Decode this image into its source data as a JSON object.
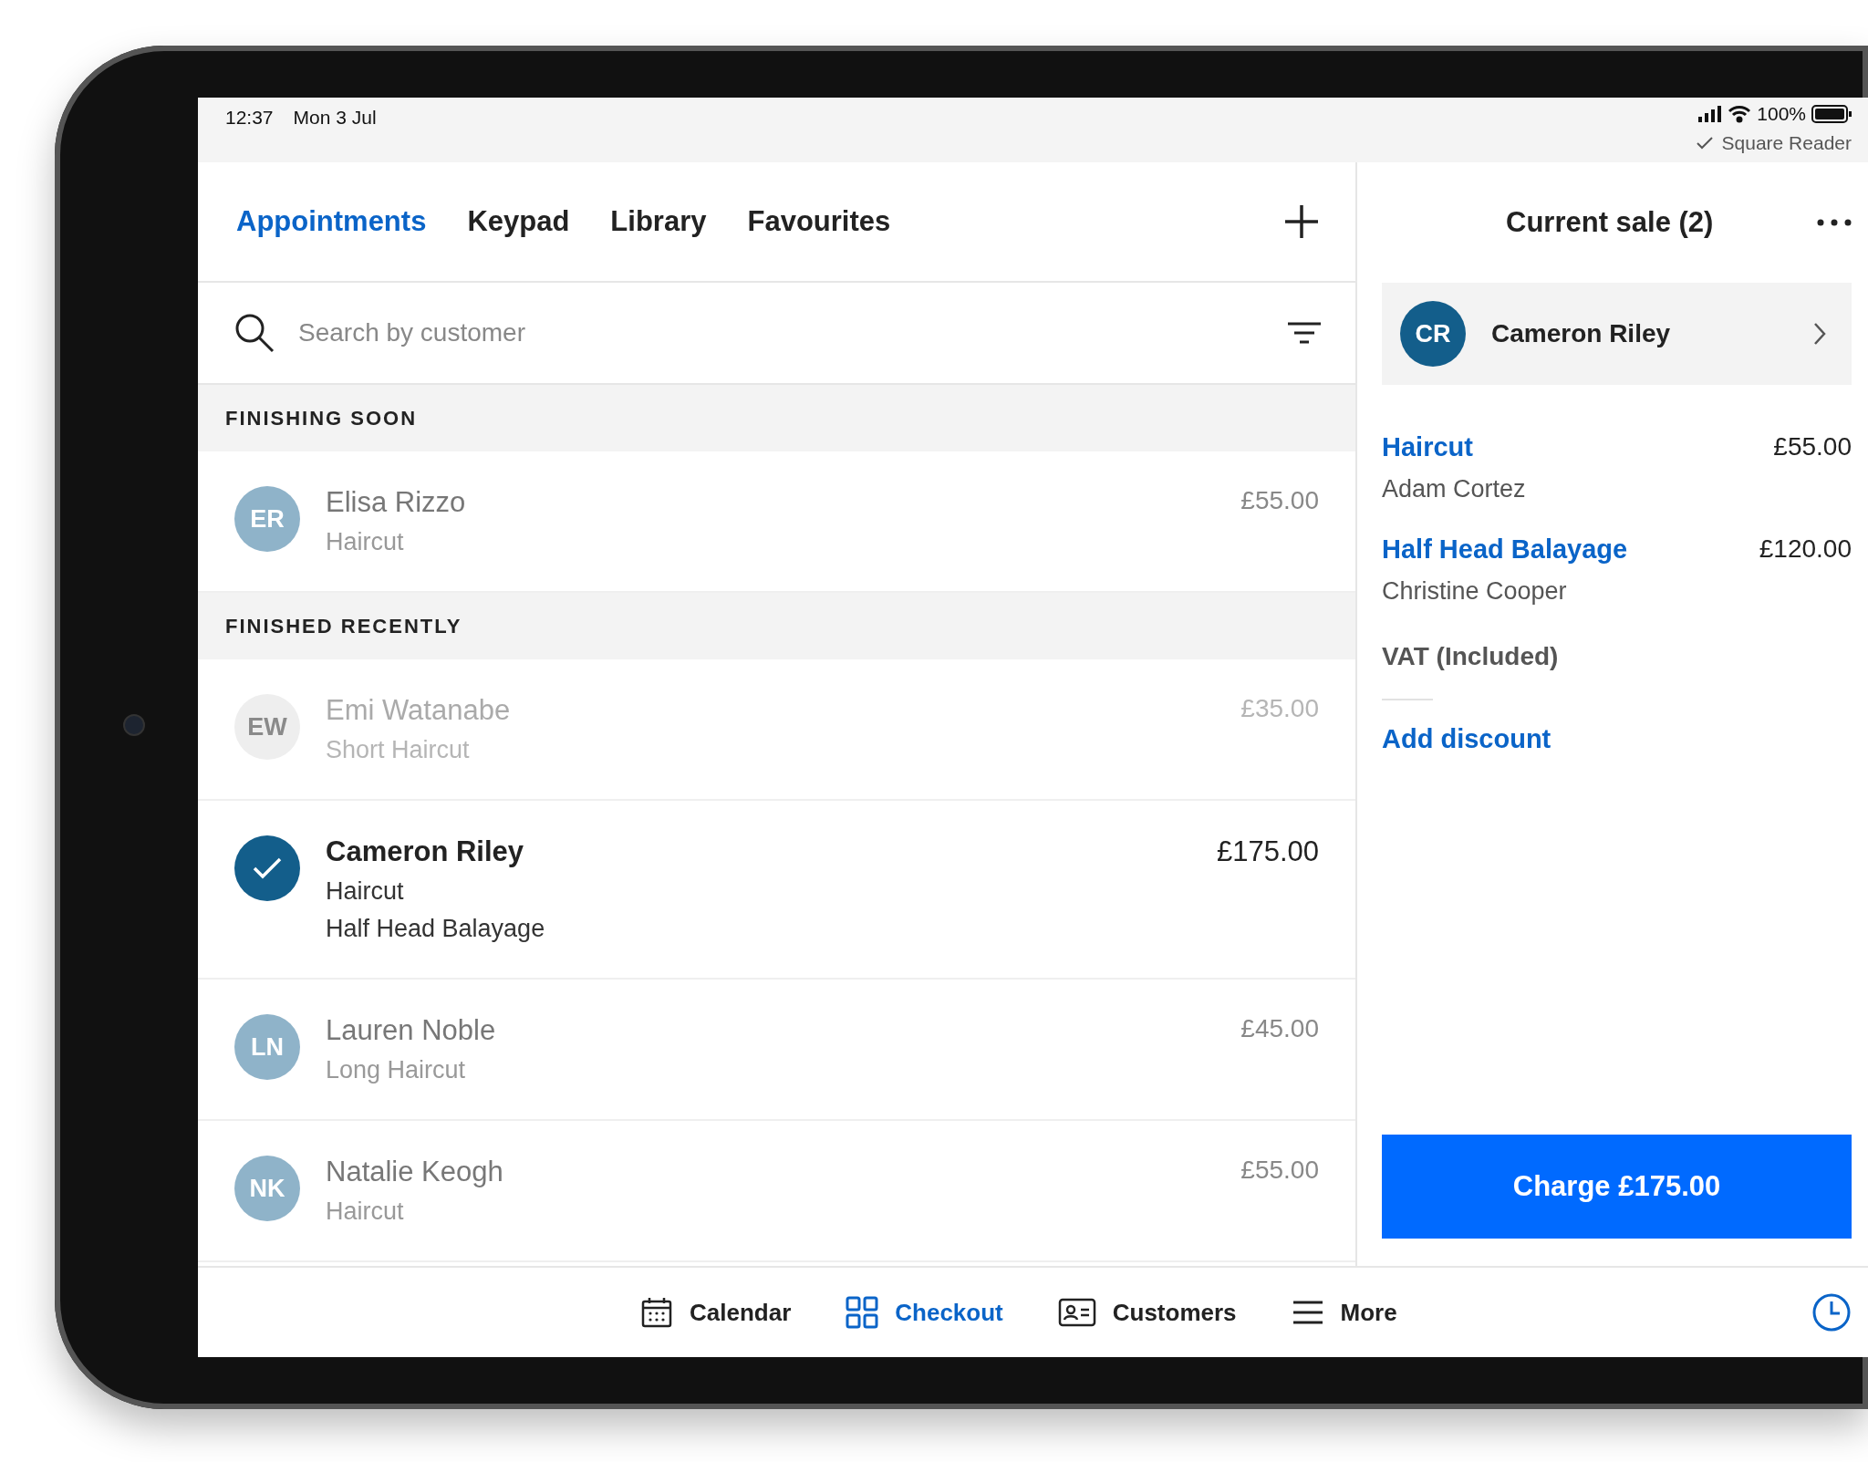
{
  "status_bar": {
    "time": "12:37",
    "date": "Mon 3 Jul",
    "battery": "100%",
    "reader": "Square Reader"
  },
  "tabs": [
    {
      "label": "Appointments",
      "selected": true
    },
    {
      "label": "Keypad",
      "selected": false
    },
    {
      "label": "Library",
      "selected": false
    },
    {
      "label": "Favourites",
      "selected": false
    }
  ],
  "search": {
    "placeholder": "Search by customer"
  },
  "sections": [
    {
      "title": "FINISHING SOON",
      "rows": [
        {
          "initials": "ER",
          "name": "Elisa Rizzo",
          "services": [
            "Haircut"
          ],
          "price": "£55.00",
          "selected": false,
          "disabled": false
        }
      ]
    },
    {
      "title": "FINISHED RECENTLY",
      "rows": [
        {
          "initials": "EW",
          "name": "Emi Watanabe",
          "services": [
            "Short Haircut"
          ],
          "price": "£35.00",
          "selected": false,
          "disabled": true
        },
        {
          "name": "Cameron Riley",
          "services": [
            "Haircut",
            "Half Head Balayage"
          ],
          "price": "£175.00",
          "selected": true,
          "disabled": false
        },
        {
          "initials": "LN",
          "name": "Lauren Noble",
          "services": [
            "Long Haircut"
          ],
          "price": "£45.00",
          "selected": false,
          "disabled": false
        },
        {
          "initials": "NK",
          "name": "Natalie Keogh",
          "services": [
            "Haircut"
          ],
          "price": "£55.00",
          "selected": false,
          "disabled": false
        }
      ]
    }
  ],
  "sale": {
    "title": "Current sale (2)",
    "customer": {
      "initials": "CR",
      "name": "Cameron Riley"
    },
    "items": [
      {
        "name": "Haircut",
        "staff": "Adam Cortez",
        "price": "£55.00"
      },
      {
        "name": "Half Head Balayage",
        "staff": "Christine Cooper",
        "price": "£120.00"
      }
    ],
    "vat": "VAT (Included)",
    "discount": "Add discount",
    "charge": "Charge £175.00"
  },
  "nav": [
    {
      "kind": "calendar",
      "label": "Calendar",
      "selected": false
    },
    {
      "kind": "grid",
      "label": "Checkout",
      "selected": true
    },
    {
      "kind": "card",
      "label": "Customers",
      "selected": false
    },
    {
      "kind": "menu",
      "label": "More",
      "selected": false
    }
  ]
}
